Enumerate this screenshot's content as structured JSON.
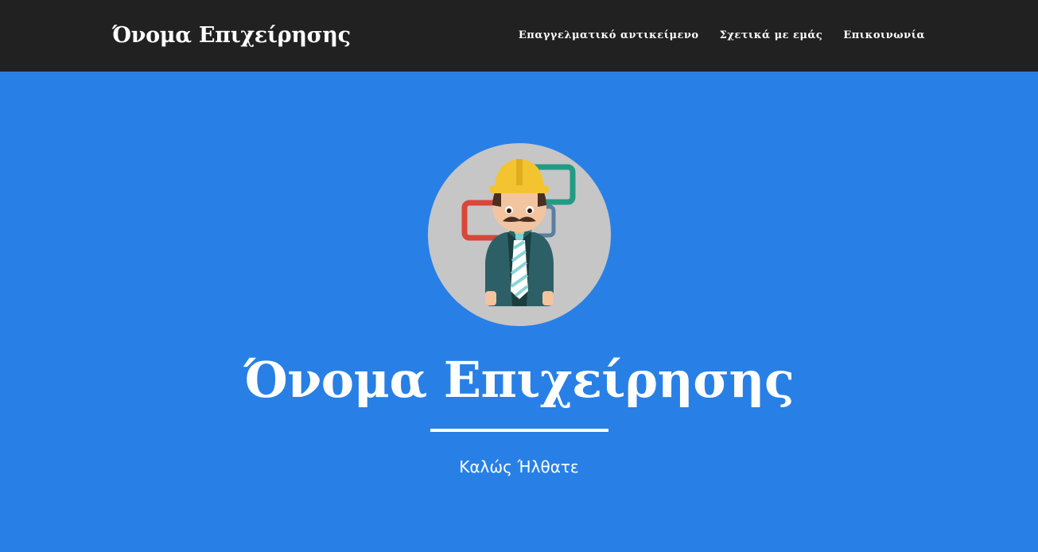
{
  "navbar": {
    "brand": "Όνομα Επιχείρησης",
    "links": [
      "Επαγγελματικό αντικείμενο",
      "Σχετικά με εμάς",
      "Επικοινωνία"
    ]
  },
  "hero": {
    "avatar_icon": "construction-worker-icon",
    "title": "Όνομα Επιχείρησης",
    "subtitle": "Καλώς Ήλθατε"
  },
  "colors": {
    "navbar_bg": "#212121",
    "hero_bg": "#2880e6",
    "avatar_bg": "#c6c6c6",
    "text": "#ffffff"
  }
}
